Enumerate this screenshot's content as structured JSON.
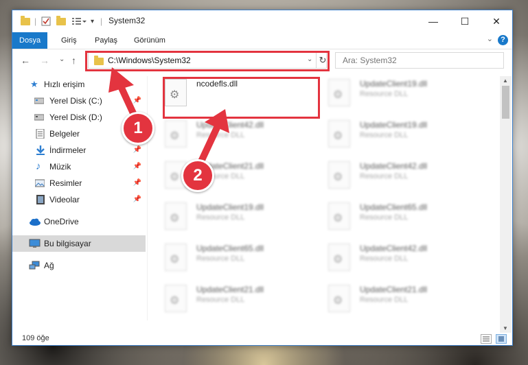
{
  "window": {
    "title": "System32",
    "controls": {
      "minimize": "—",
      "maximize": "☐",
      "close": "✕"
    }
  },
  "ribbon": {
    "tabs": [
      "Dosya",
      "Giriş",
      "Paylaş",
      "Görünüm"
    ],
    "help": "?"
  },
  "navigation": {
    "back": "←",
    "forward": "→",
    "recent": "⌄",
    "up": "↑",
    "address": "C:\\Windows\\System32",
    "search_placeholder": "Ara: System32"
  },
  "sidebar": {
    "items": [
      {
        "label": "Hızlı erişim",
        "icon": "star-icon",
        "pinned": false
      },
      {
        "label": "Yerel Disk (C:)",
        "icon": "drive-icon",
        "pinned": true
      },
      {
        "label": "Yerel Disk (D:)",
        "icon": "drive-icon",
        "pinned": true
      },
      {
        "label": "Belgeler",
        "icon": "document-icon",
        "pinned": false
      },
      {
        "label": "İndirmeler",
        "icon": "download-icon",
        "pinned": true
      },
      {
        "label": "Müzik",
        "icon": "music-icon",
        "pinned": true
      },
      {
        "label": "Resimler",
        "icon": "pictures-icon",
        "pinned": true
      },
      {
        "label": "Videolar",
        "icon": "video-icon",
        "pinned": true
      },
      {
        "label": "OneDrive",
        "icon": "cloud-icon",
        "pinned": false
      },
      {
        "label": "Bu bilgisayar",
        "icon": "computer-icon",
        "pinned": false
      },
      {
        "label": "Ağ",
        "icon": "network-icon",
        "pinned": false
      }
    ],
    "pin_glyph": "📌"
  },
  "files": {
    "left": [
      {
        "name": "ncodefls.dll",
        "type": "",
        "highlight": true
      },
      {
        "name": "UpdateClient42.dll",
        "type": "Resource DLL"
      },
      {
        "name": "UpdateClient21.dll",
        "type": "Resource DLL"
      },
      {
        "name": "UpdateClient19.dll",
        "type": "Resource DLL"
      },
      {
        "name": "UpdateClient65.dll",
        "type": "Resource DLL"
      },
      {
        "name": "UpdateClient21.dll",
        "type": "Resource DLL"
      }
    ],
    "right": [
      {
        "name": "UpdateClient19.dll",
        "type": "Resource DLL"
      },
      {
        "name": "UpdateClient19.dll",
        "type": "Resource DLL"
      },
      {
        "name": "UpdateClient42.dll",
        "type": "Resource DLL"
      },
      {
        "name": "UpdateClient65.dll",
        "type": "Resource DLL"
      },
      {
        "name": "UpdateClient42.dll",
        "type": "Resource DLL"
      },
      {
        "name": "UpdateClient21.dll",
        "type": "Resource DLL"
      }
    ]
  },
  "status": {
    "count": "109 öğe"
  },
  "annotations": {
    "step1": "1",
    "step2": "2"
  },
  "colors": {
    "accent": "#1979ca",
    "highlight_red": "#e3343f"
  }
}
